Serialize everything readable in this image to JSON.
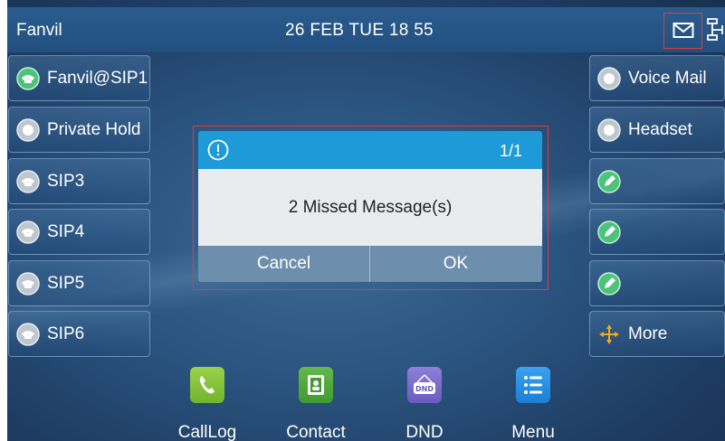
{
  "status_bar": {
    "title": "Fanvil",
    "datetime": "26 FEB TUE  18 55",
    "icons": [
      "envelope-icon",
      "network-icon"
    ]
  },
  "left_keys": [
    {
      "label": "Fanvil@SIP1",
      "icon": "phone-green-icon"
    },
    {
      "label": "Private Hold",
      "icon": "hold-icon"
    },
    {
      "label": "SIP3",
      "icon": "phone-gray-icon"
    },
    {
      "label": "SIP4",
      "icon": "phone-gray-icon"
    },
    {
      "label": "SIP5",
      "icon": "phone-gray-icon"
    },
    {
      "label": "SIP6",
      "icon": "phone-gray-icon"
    }
  ],
  "right_keys": [
    {
      "label": "Voice Mail",
      "icon": "voicemail-icon"
    },
    {
      "label": "Headset",
      "icon": "headset-icon"
    },
    {
      "label": "",
      "icon": "edit-icon"
    },
    {
      "label": "",
      "icon": "edit-icon"
    },
    {
      "label": "",
      "icon": "edit-icon"
    },
    {
      "label": "More",
      "icon": "move-arrows-icon"
    }
  ],
  "dialog": {
    "page": "1/1",
    "message": "2 Missed Message(s)",
    "cancel_label": "Cancel",
    "ok_label": "OK"
  },
  "softkeys": [
    {
      "label": "CallLog",
      "icon": "calllog-icon"
    },
    {
      "label": "Contact",
      "icon": "contact-icon"
    },
    {
      "label": "DND",
      "icon": "dnd-icon",
      "icon_text": "DND"
    },
    {
      "label": "Menu",
      "icon": "menu-icon"
    }
  ],
  "colors": {
    "accent_blue": "#1f9ad8",
    "highlight_red": "#e23a3a",
    "green": "#4cc37a"
  }
}
